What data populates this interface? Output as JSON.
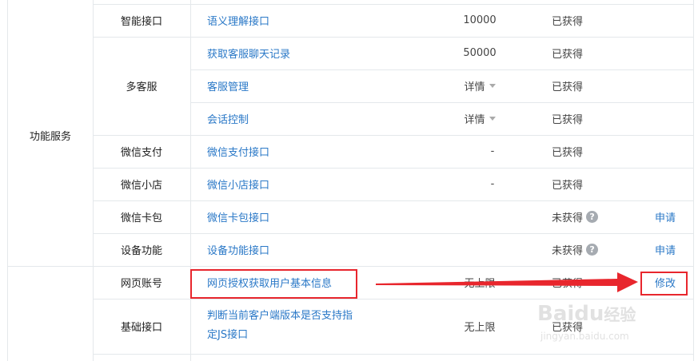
{
  "groups": [
    {
      "label": "功能服务"
    }
  ],
  "rows": [
    {
      "sub": "智能接口",
      "api": "语义理解接口",
      "limit": "10000",
      "status": "已获得",
      "action": ""
    },
    {
      "sub": "",
      "api": "获取客服聊天记录",
      "limit": "50000",
      "status": "已获得",
      "action": ""
    },
    {
      "sub": "多客服",
      "api": "客服管理",
      "limit": "详情",
      "status": "已获得",
      "action": ""
    },
    {
      "sub": "",
      "api": "会话控制",
      "limit": "详情",
      "status": "已获得",
      "action": ""
    },
    {
      "sub": "微信支付",
      "api": "微信支付接口",
      "limit": "-",
      "status": "已获得",
      "action": ""
    },
    {
      "sub": "微信小店",
      "api": "微信小店接口",
      "limit": "-",
      "status": "已获得",
      "action": ""
    },
    {
      "sub": "微信卡包",
      "api": "微信卡包接口",
      "limit": "",
      "status": "未获得",
      "action": "申请"
    },
    {
      "sub": "设备功能",
      "api": "设备功能接口",
      "limit": "",
      "status": "未获得",
      "action": "申请"
    },
    {
      "sub": "网页账号",
      "api": "网页授权获取用户基本信息",
      "limit": "无上限",
      "status": "已获得",
      "action": "修改"
    },
    {
      "sub": "基础接口",
      "api_line1": "判断当前客户端版本是否支持指",
      "api_line2": "定JS接口",
      "limit": "无上限",
      "status": "已获得",
      "action": ""
    }
  ],
  "help_icon": "?",
  "watermark": {
    "brand": "Baidu",
    "sub": "经验",
    "url": "jingyan.baidu.com"
  },
  "colors": {
    "link": "#2a78c7",
    "highlight": "#e8262d",
    "border": "#e4e8eb"
  }
}
